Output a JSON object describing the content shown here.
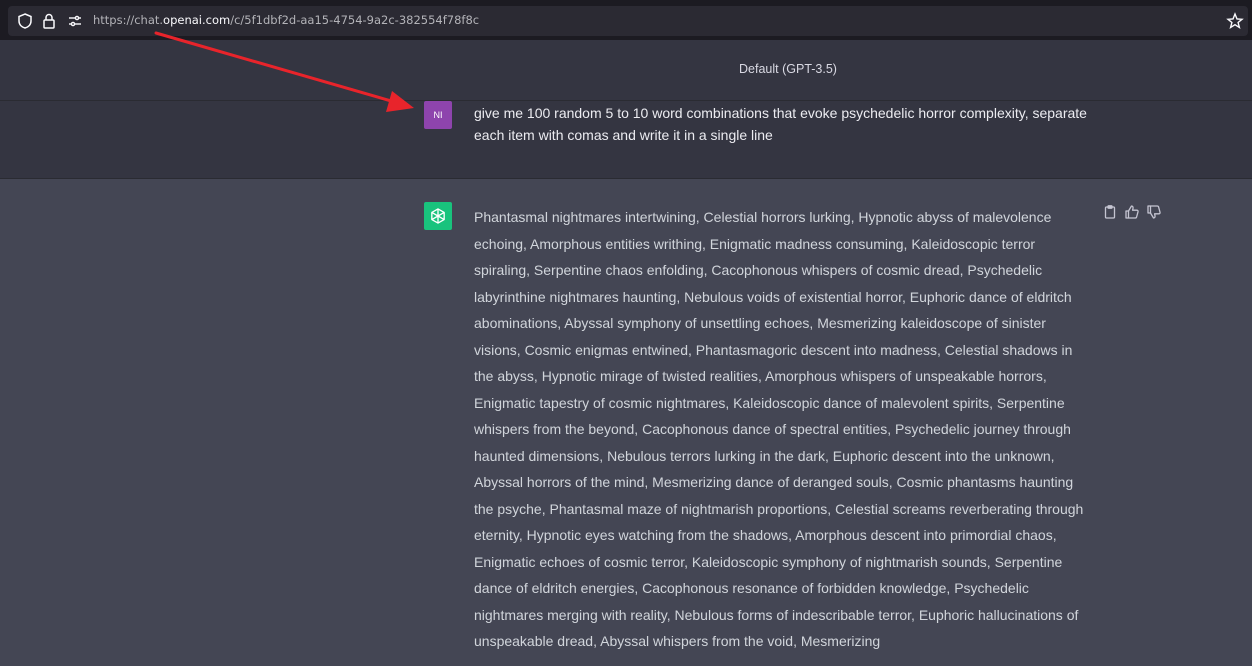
{
  "browser": {
    "url_prefix": "https://chat.",
    "url_domain": "openai.com",
    "url_path": "/c/5f1dbf2d-aa15-4754-9a2c-382554f78f8c"
  },
  "header": {
    "model": "Default (GPT-3.5)"
  },
  "user_message": {
    "avatar_initials": "NI",
    "text": "give me 100 random 5 to 10 word combinations that evoke psychedelic horror complexity, separate each item with comas and write it in a single line"
  },
  "assistant_message": {
    "text": "Phantasmal nightmares intertwining, Celestial horrors lurking, Hypnotic abyss of malevolence echoing, Amorphous entities writhing, Enigmatic madness consuming, Kaleidoscopic terror spiraling, Serpentine chaos enfolding, Cacophonous whispers of cosmic dread, Psychedelic labyrinthine nightmares haunting, Nebulous voids of existential horror, Euphoric dance of eldritch abominations, Abyssal symphony of unsettling echoes, Mesmerizing kaleidoscope of sinister visions, Cosmic enigmas entwined, Phantasmagoric descent into madness, Celestial shadows in the abyss, Hypnotic mirage of twisted realities, Amorphous whispers of unspeakable horrors, Enigmatic tapestry of cosmic nightmares, Kaleidoscopic dance of malevolent spirits, Serpentine whispers from the beyond, Cacophonous dance of spectral entities, Psychedelic journey through haunted dimensions, Nebulous terrors lurking in the dark, Euphoric descent into the unknown, Abyssal horrors of the mind, Mesmerizing dance of deranged souls, Cosmic phantasms haunting the psyche, Phantasmal maze of nightmarish proportions, Celestial screams reverberating through eternity, Hypnotic eyes watching from the shadows, Amorphous descent into primordial chaos, Enigmatic echoes of cosmic terror, Kaleidoscopic symphony of nightmarish sounds, Serpentine dance of eldritch energies, Cacophonous resonance of forbidden knowledge, Psychedelic nightmares merging with reality, Nebulous forms of indescribable terror, Euphoric hallucinations of unspeakable dread, Abyssal whispers from the void, Mesmerizing"
  },
  "icons": {
    "shield": "shield-icon",
    "lock": "lock-icon",
    "permissions": "permissions-icon",
    "star": "bookmark-star-icon",
    "copy": "clipboard-icon",
    "thumbs_up": "thumbs-up-icon",
    "thumbs_down": "thumbs-down-icon",
    "openai": "openai-logo-icon"
  },
  "colors": {
    "user_avatar": "#8e44ad",
    "bot_avatar": "#19c37d",
    "annotation_arrow": "#e8242b"
  }
}
